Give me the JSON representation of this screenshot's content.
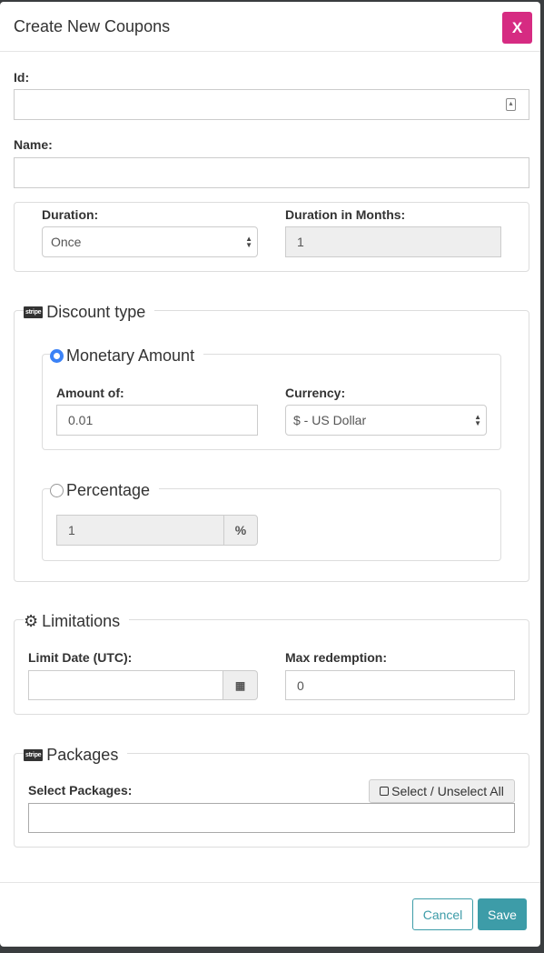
{
  "modal": {
    "title": "Create New Coupons",
    "close_label": "X"
  },
  "fields": {
    "id": {
      "label": "Id:",
      "value": ""
    },
    "name": {
      "label": "Name:",
      "value": ""
    },
    "duration": {
      "label": "Duration:",
      "value": "Once"
    },
    "duration_months": {
      "label": "Duration in Months:",
      "value": "1"
    }
  },
  "discount": {
    "legend": "Discount type",
    "stripe_badge": "stripe",
    "monetary": {
      "legend": "Monetary Amount",
      "selected": true,
      "amount_label": "Amount of:",
      "amount_value": "0.01",
      "currency_label": "Currency:",
      "currency_value": "$ - US Dollar"
    },
    "percentage": {
      "legend": "Percentage",
      "selected": false,
      "value": "1",
      "addon": "%"
    }
  },
  "limitations": {
    "legend": "Limitations",
    "limit_date_label": "Limit Date (UTC):",
    "limit_date_value": "",
    "max_redemption_label": "Max redemption:",
    "max_redemption_value": "0"
  },
  "packages": {
    "legend": "Packages",
    "stripe_badge": "stripe",
    "select_label": "Select Packages:",
    "select_all_label": "Select / Unselect All",
    "value": ""
  },
  "footer": {
    "cancel_label": "Cancel",
    "save_label": "Save"
  },
  "colors": {
    "close": "#d62b82",
    "save": "#3d9ca8",
    "radio": "#3b82f6"
  }
}
